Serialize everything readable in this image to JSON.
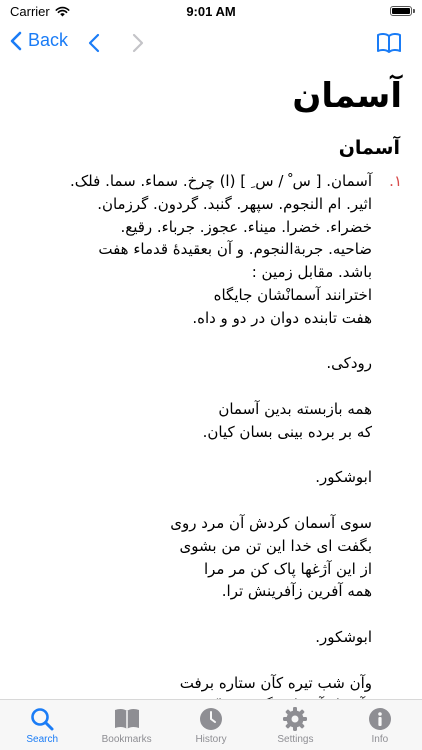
{
  "status_bar": {
    "carrier": "Carrier",
    "time": "9:01 AM",
    "battery_level": 1.0
  },
  "nav": {
    "back_label": "Back",
    "back_icon": "chevron-left-icon",
    "prev_icon": "chevron-left-icon",
    "next_icon": "chevron-right-icon",
    "book_icon": "book-icon",
    "accent_color": "#1a7cf6"
  },
  "page": {
    "title": "آسمان"
  },
  "entry": {
    "headword": "آسمان",
    "number": "۱.",
    "number_color": "#d84a4a",
    "lines": [
      "آسمان. [ س ْ / س ِ ] (ا) چرخ. سماء. سما. فلک.",
      "اثیر. ام النجوم. سپهر. گنبد. گردون. گرزمان.",
      "خضراء. خضرا. میناء. عجوز. جرباء. رقیع.",
      "ضاحیه. جربةالنجوم. و آن بعقیدهٔ قدماء هفت",
      "باشد. مقابل زمین :",
      "اخترانند آسمانْشان جایگاه",
      "هفت تابنده دوان در دو و داه.",
      "",
      "رودکی.",
      "",
      "همه بازبسته بدین آسمان",
      "که بر برده بینی بسان کیان.",
      "",
      "ابوشکور.",
      "",
      "سوی آسمان کردش آن مرد روی",
      "بگفت ای خدا این تن من بشوی",
      "از این آژغها پاک کن مر مرا",
      "همه آفرین زآفرینش ترا.",
      "",
      "ابوشکور.",
      "",
      "وآن شب تیره کآن ستاره برفت",
      "وآمد از آسمان بگوش تراک."
    ]
  },
  "tabs": [
    {
      "label": "Search",
      "icon": "search-icon",
      "active": true
    },
    {
      "label": "Bookmarks",
      "icon": "bookmarks-icon",
      "active": false
    },
    {
      "label": "History",
      "icon": "history-icon",
      "active": false
    },
    {
      "label": "Settings",
      "icon": "gear-icon",
      "active": false
    },
    {
      "label": "Info",
      "icon": "info-icon",
      "active": false
    }
  ]
}
